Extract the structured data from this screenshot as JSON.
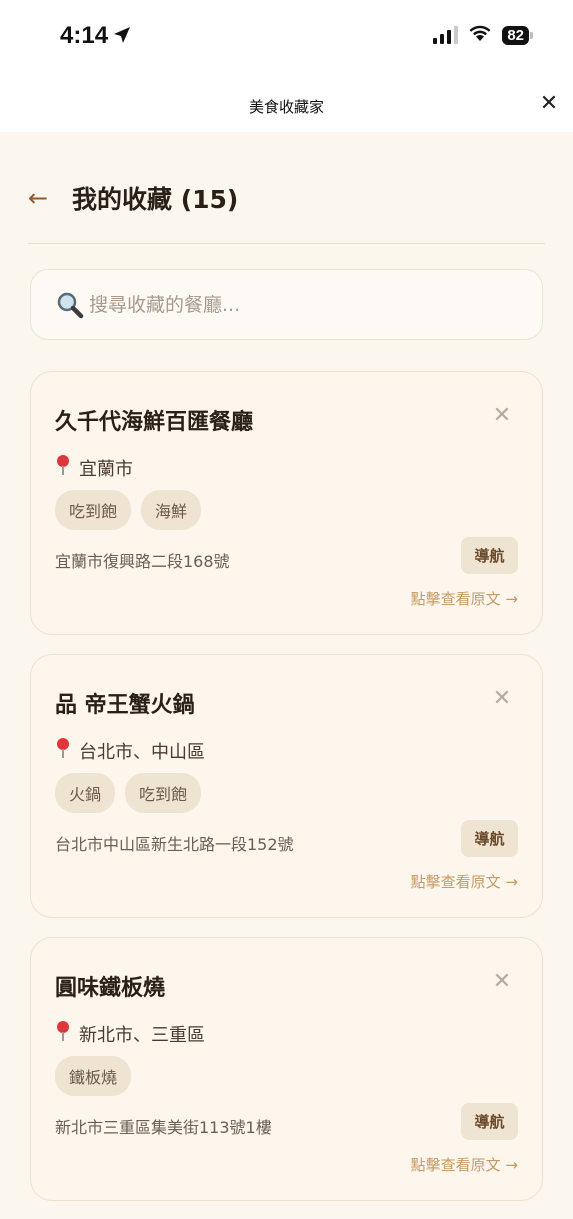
{
  "status_bar": {
    "time": "4:14",
    "battery": "82"
  },
  "navbar": {
    "title": "美食收藏家",
    "close": "✕"
  },
  "header": {
    "back": "←",
    "title": "我的收藏 (15)"
  },
  "search": {
    "placeholder": "搜尋收藏的餐廳..."
  },
  "cards": [
    {
      "name": "久千代海鮮百匯餐廳",
      "location": "宜蘭市",
      "tags": [
        "吃到飽",
        "海鮮"
      ],
      "address": "宜蘭市復興路二段168號",
      "nav_label": "導航",
      "link_label": "點擊查看原文 →",
      "remove": "✕"
    },
    {
      "name": "品 帝王蟹火鍋",
      "location": "台北市、中山區",
      "tags": [
        "火鍋",
        "吃到飽"
      ],
      "address": "台北市中山區新生北路一段152號",
      "nav_label": "導航",
      "link_label": "點擊查看原文 →",
      "remove": "✕"
    },
    {
      "name": "圓味鐵板燒",
      "location": "新北市、三重區",
      "tags": [
        "鐵板燒"
      ],
      "address": "新北市三重區集美街113號1樓",
      "nav_label": "導航",
      "link_label": "點擊查看原文 →",
      "remove": "✕"
    }
  ]
}
